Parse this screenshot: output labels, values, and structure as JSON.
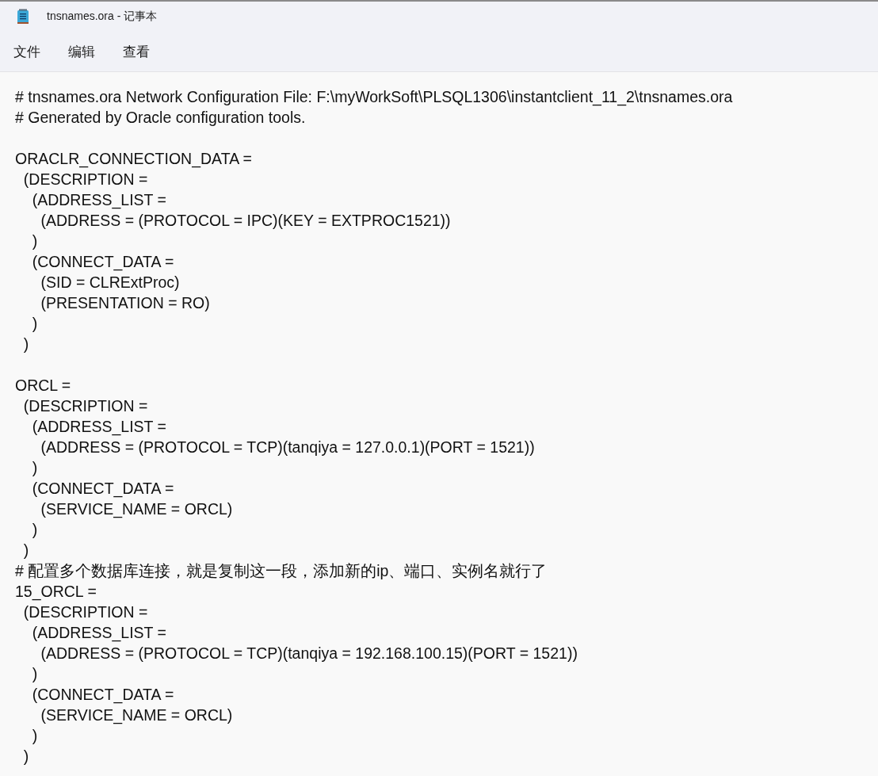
{
  "window": {
    "title": "tnsnames.ora - 记事本"
  },
  "menu": [
    "文件",
    "编辑",
    "查看"
  ],
  "editor": {
    "blocks": [
      [
        "# tnsnames.ora Network Configuration File: F:\\myWorkSoft\\PLSQL1306\\instantclient_11_2\\tnsnames.ora",
        "# Generated by Oracle configuration tools."
      ],
      [
        "ORACLR_CONNECTION_DATA =",
        "  (DESCRIPTION =",
        "    (ADDRESS_LIST =",
        "      (ADDRESS = (PROTOCOL = IPC)(KEY = EXTPROC1521))",
        "    )",
        "    (CONNECT_DATA =",
        "      (SID = CLRExtProc)",
        "      (PRESENTATION = RO)",
        "    )",
        "  )"
      ],
      [
        "ORCL =",
        "  (DESCRIPTION =",
        "    (ADDRESS_LIST =",
        "      (ADDRESS = (PROTOCOL = TCP)(tanqiya = 127.0.0.1)(PORT = 1521))",
        "    )",
        "    (CONNECT_DATA =",
        "      (SERVICE_NAME = ORCL)",
        "    )",
        "  )",
        "# 配置多个数据库连接，就是复制这一段，添加新的ip、端口、实例名就行了",
        "15_ORCL =",
        "  (DESCRIPTION =",
        "    (ADDRESS_LIST =",
        "      (ADDRESS = (PROTOCOL = TCP)(tanqiya = 192.168.100.15)(PORT = 1521))",
        "    )",
        "    (CONNECT_DATA =",
        "      (SERVICE_NAME = ORCL)",
        "    )",
        "  )"
      ]
    ]
  }
}
